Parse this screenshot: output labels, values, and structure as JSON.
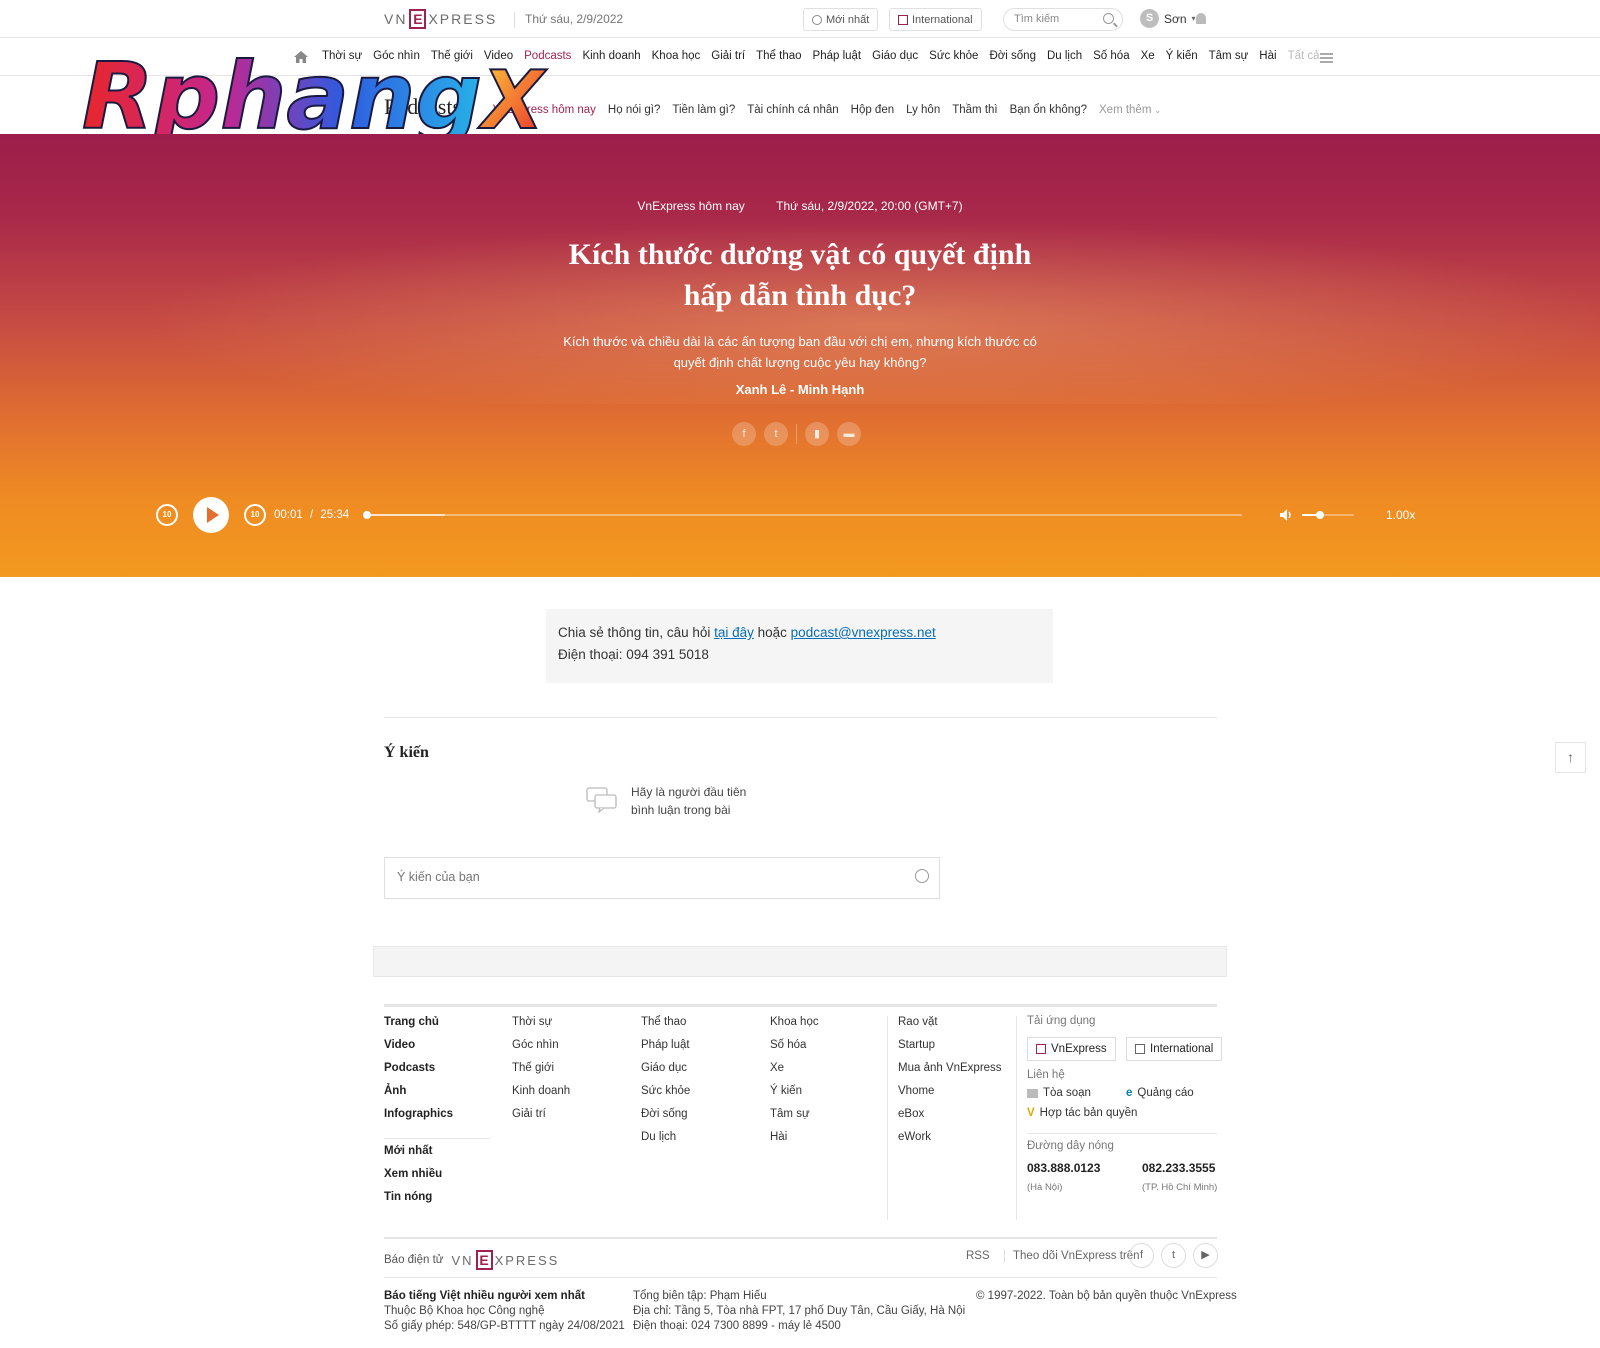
{
  "top": {
    "logo": {
      "pre": "VN",
      "e": "E",
      "post": "XPRESS"
    },
    "date": "Thứ sáu, 2/9/2022",
    "latest": "Mới nhất",
    "international": "International",
    "search_placeholder": "Tìm kiếm",
    "user_initial": "S",
    "user_name": "Sơn"
  },
  "mainnav": [
    "Thời sự",
    "Góc nhìn",
    "Thế giới",
    "Video",
    "Podcasts",
    "Kinh doanh",
    "Khoa học",
    "Giải trí",
    "Thể thao",
    "Pháp luật",
    "Giáo dục",
    "Sức khỏe",
    "Đời sống",
    "Du lịch",
    "Số hóa",
    "Xe",
    "Ý kiến",
    "Tâm sự",
    "Hài",
    "Tất cả"
  ],
  "subnav": {
    "title": "Podcasts",
    "items": [
      "VnExpress hôm nay",
      "Họ nói gì?",
      "Tiền làm gì?",
      "Tài chính cá nhân",
      "Hộp đen",
      "Ly hôn",
      "Thầm thì",
      "Bạn ổn không?",
      "Xem thêm"
    ]
  },
  "watermark": "RphangX",
  "hero": {
    "category": "VnExpress hôm nay",
    "datetime": "Thứ sáu, 2/9/2022, 20:00 (GMT+7)",
    "title_line1": "Kích thước dương vật có quyết định",
    "title_line2": "hấp dẫn tình dục?",
    "description": "Kích thước và chiều dài là các ấn tượng ban đầu với chị em, nhưng kích thước có quyết định chất lượng cuộc yêu hay không?",
    "author": "Xanh Lê - Minh Hạnh",
    "share_icons": [
      "facebook-icon",
      "twitter-icon",
      "bookmark-icon",
      "comment-icon"
    ]
  },
  "player": {
    "skip_back": "10",
    "skip_fwd": "10",
    "current": "00:01",
    "separator": "/",
    "duration": "25:34",
    "progress_fraction": 0.001,
    "buffered_fraction": 0.09,
    "volume_fraction": 0.35,
    "speed": "1.00x"
  },
  "contact": {
    "line1_pre": "Chia sẻ thông tin, câu hỏi ",
    "link1": "tại đây",
    "line1_mid": " hoặc ",
    "link2": "podcast@vnexpress.net",
    "line2": "Điện thoại: 094 391 5018"
  },
  "comments": {
    "title": "Ý kiến",
    "empty_line1": "Hãy là người đầu tiên",
    "empty_line2": "bình luận trong bài",
    "input_placeholder": "Ý kiến của bạn"
  },
  "footer": {
    "col1": [
      "Trang chủ",
      "Video",
      "Podcasts",
      "Ảnh",
      "Infographics"
    ],
    "col1b": [
      "Mới nhất",
      "Xem nhiều",
      "Tin nóng"
    ],
    "col2": [
      "Thời sự",
      "Góc nhìn",
      "Thế giới",
      "Kinh doanh",
      "Giải trí"
    ],
    "col3": [
      "Thể thao",
      "Pháp luật",
      "Giáo dục",
      "Sức khỏe",
      "Đời sống",
      "Du lịch"
    ],
    "col4": [
      "Khoa học",
      "Số hóa",
      "Xe",
      "Ý kiến",
      "Tâm sự",
      "Hài"
    ],
    "col5": [
      "Rao vặt",
      "Startup",
      "Mua ảnh VnExpress",
      "Vhome",
      "eBox",
      "eWork"
    ],
    "apps_label": "Tải ứng dụng",
    "app1": "VnExpress",
    "app2": "International",
    "contact_label": "Liên hệ",
    "newsroom": "Tòa soạn",
    "ads": "Quảng cáo",
    "copyright_coop": "Hợp tác bản quyền",
    "hotline_label": "Đường dây nóng",
    "phone1": "083.888.0123",
    "city1": "(Hà Nội)",
    "phone2": "082.233.3555",
    "city2": "(TP. Hồ Chí Minh)",
    "bao_dien_tu": "Báo điện tử",
    "rss": "RSS",
    "follow": "Theo dõi VnExpress trên",
    "b1": "Báo tiếng Việt nhiều người xem nhất",
    "b2": "Thuộc Bộ Khoa học Công nghệ",
    "b3": "Số giấy phép: 548/GP-BTTTT ngày 24/08/2021",
    "m1": "Tổng biên tập: Phạm Hiếu",
    "m2": "Địa chỉ: Tầng 5, Tòa nhà FPT, 17 phố Duy Tân, Cầu Giấy, Hà Nội",
    "m3": "Điện thoại: 024 7300 8899 - máy lẻ 4500",
    "r1": "© 1997-2022. Toàn bộ bản quyền thuộc VnExpress"
  },
  "colors": {
    "brand": "#9f224e",
    "link": "#076db6"
  }
}
